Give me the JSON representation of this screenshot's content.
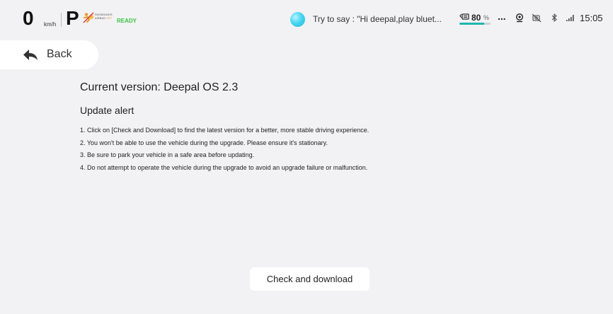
{
  "status_bar": {
    "speed": "0",
    "speed_unit": "km/h",
    "gear": "P",
    "airbag_line1": "PASSENGER",
    "airbag_line2": "AIRBAG",
    "airbag_state": "OFF",
    "ready": "READY",
    "voice_hint": "Try to say : \"Hi deepal,play bluet...",
    "battery_value": "80",
    "battery_unit": "%",
    "battery_level": 0.8,
    "more_label": "...",
    "time": "15:05",
    "icons": [
      "airbag-icon",
      "voice-assistant-icon",
      "battery-icon",
      "more-icon",
      "driver-camera-icon",
      "camera-off-icon",
      "bluetooth-icon",
      "signal-icon"
    ],
    "colors": {
      "ready": "#37c43f",
      "airbag_off": "#e39a2a",
      "accent": "#1fb7b0"
    }
  },
  "nav": {
    "back_label": "Back",
    "back_icon": "back-arrow-icon"
  },
  "content": {
    "current_version": "Current version: Deepal OS 2.3",
    "alert_title": "Update alert",
    "alert_items": [
      "1. Click on [Check and Download] to find the latest version for a better, more stable driving experience.",
      "2. You won't be able to use the vehicle during the upgrade. Please ensure it's stationary.",
      "3. Be sure to park your vehicle in a safe area before updating.",
      "4. Do not attempt to operate the vehicle during the upgrade to avoid an upgrade failure or malfunction."
    ],
    "check_button_label": "Check and download"
  }
}
